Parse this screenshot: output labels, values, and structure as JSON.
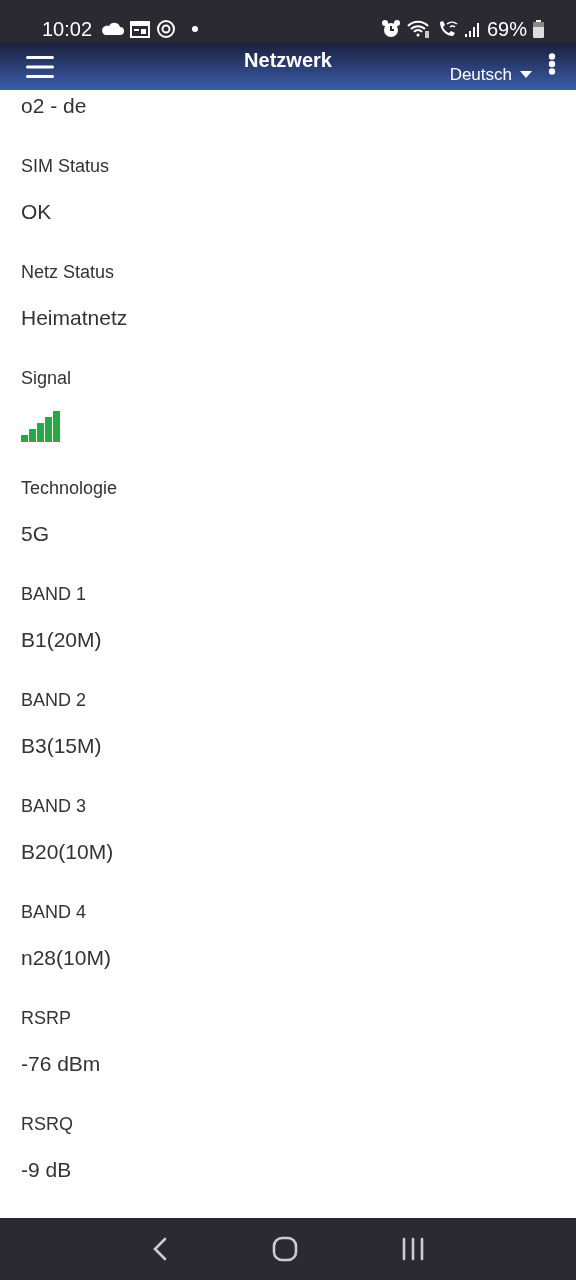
{
  "status_bar": {
    "time": "10:02",
    "battery": "69%"
  },
  "app_bar": {
    "title": "Netzwerk",
    "language": "Deutsch"
  },
  "fields": [
    {
      "kind": "text",
      "value": "o2 - de"
    },
    {
      "kind": "text",
      "label": "SIM Status",
      "value": "OK"
    },
    {
      "kind": "text",
      "label": "Netz Status",
      "value": "Heimatnetz"
    },
    {
      "kind": "signal",
      "label": "Signal"
    },
    {
      "kind": "text",
      "label": "Technologie",
      "value": "5G"
    },
    {
      "kind": "text",
      "label": "BAND 1",
      "value": "B1(20M)"
    },
    {
      "kind": "text",
      "label": "BAND 2",
      "value": "B3(15M)"
    },
    {
      "kind": "text",
      "label": "BAND 3",
      "value": "B20(10M)"
    },
    {
      "kind": "text",
      "label": "BAND 4",
      "value": "n28(10M)"
    },
    {
      "kind": "text",
      "label": "RSRP",
      "value": "-76 dBm"
    },
    {
      "kind": "text",
      "label": "RSRQ",
      "value": "-9 dB"
    }
  ]
}
